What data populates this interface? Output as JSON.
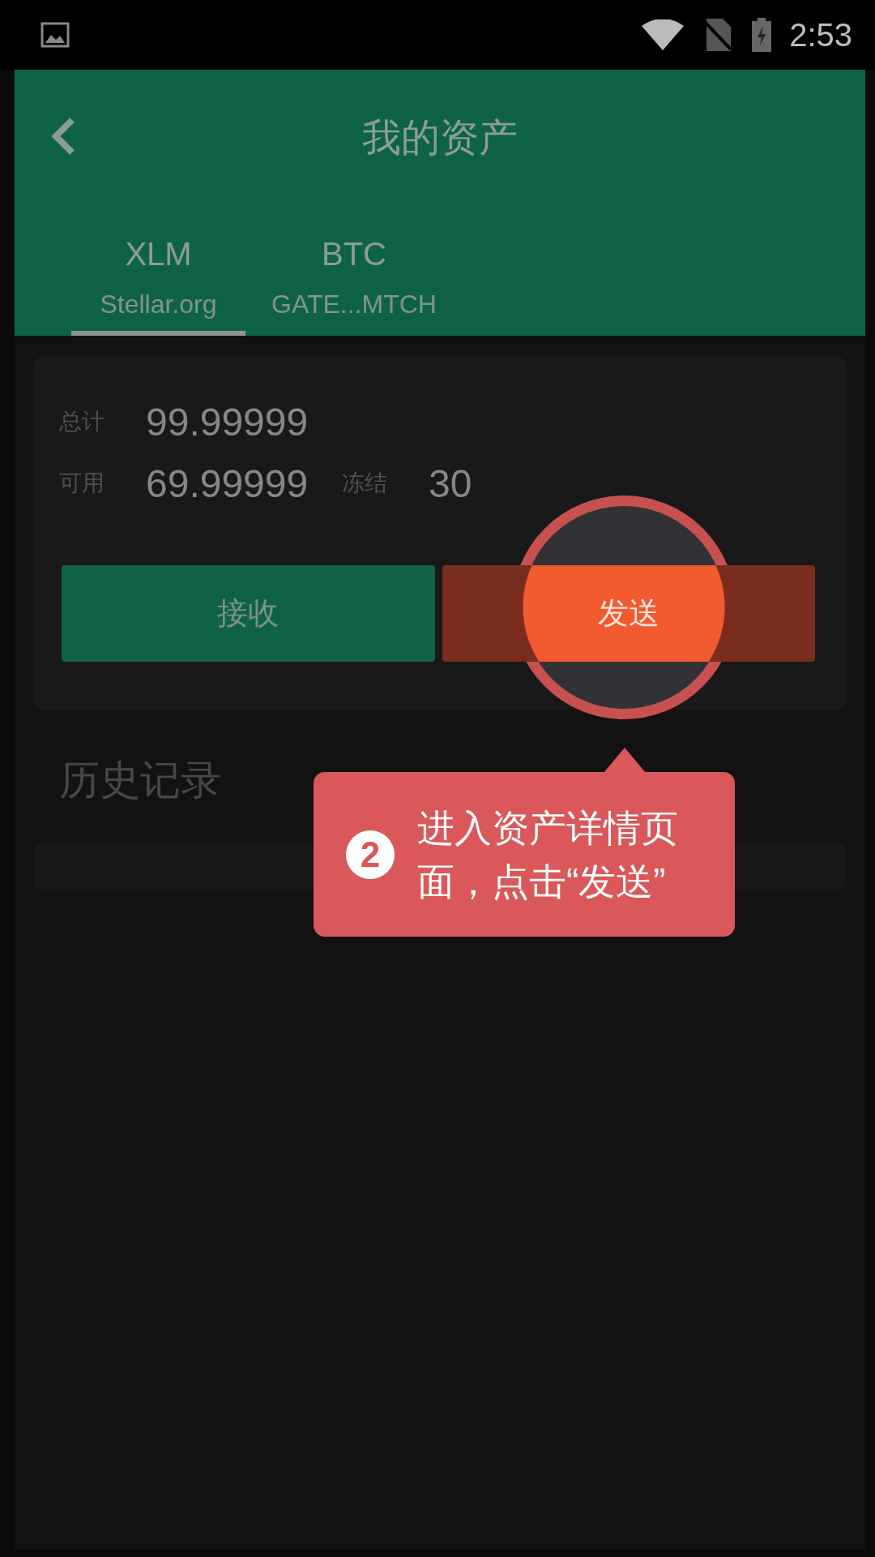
{
  "status_bar": {
    "time": "2:53"
  },
  "header": {
    "title": "我的资产"
  },
  "tabs": [
    {
      "symbol": "XLM",
      "issuer": "Stellar.org",
      "selected": true
    },
    {
      "symbol": "BTC",
      "issuer": "GATE...MTCH",
      "selected": false
    }
  ],
  "balance": {
    "total_label": "总计",
    "total": "99.99999",
    "available_label": "可用",
    "available": "69.99999",
    "frozen_label": "冻结",
    "frozen": "30"
  },
  "buttons": [
    {
      "label": "接收",
      "kind": "receive",
      "spotlighted": false
    },
    {
      "label": "发送",
      "kind": "send",
      "spotlighted": true
    }
  ],
  "history": {
    "title": "历史记录"
  },
  "tooltip": {
    "step": "2",
    "text": "进入资产详情页面，点击“发送”"
  }
}
